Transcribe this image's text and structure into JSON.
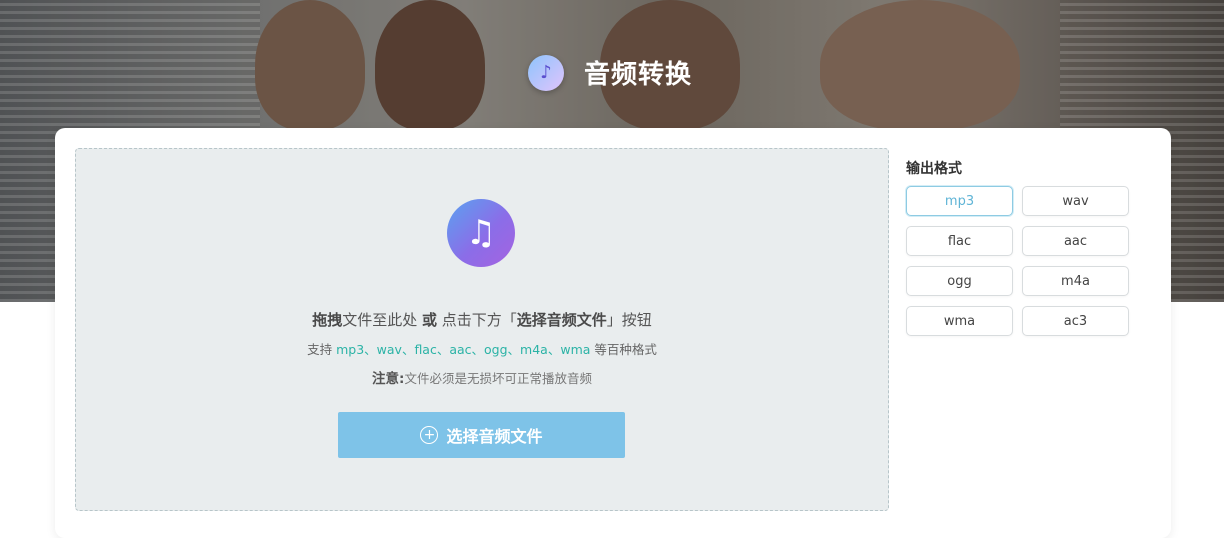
{
  "header": {
    "title": "音频转换",
    "brand_icon": "audio-converter-logo-icon"
  },
  "dropzone": {
    "icon": "music-note-icon",
    "instruction": {
      "part1_bold": "拖拽",
      "part2": "文件至此处 ",
      "part3_bold": "或",
      "part4": " 点击下方「",
      "part5_bold": "选择音频文件",
      "part6": "」按钮"
    },
    "support": {
      "prefix": "支持 ",
      "formats": "mp3、wav、flac、aac、ogg、m4a、wma",
      "suffix": " 等百种格式"
    },
    "note": {
      "label": "注意:",
      "text": "文件必须是无损坏可正常播放音频"
    },
    "select_button": "选择音频文件"
  },
  "output": {
    "title": "输出格式",
    "formats": [
      "mp3",
      "wav",
      "flac",
      "aac",
      "ogg",
      "m4a",
      "wma",
      "ac3"
    ],
    "selected": "mp3"
  },
  "colors": {
    "accent": "#7ec3e8",
    "format_highlight": "#2bb3a6"
  }
}
